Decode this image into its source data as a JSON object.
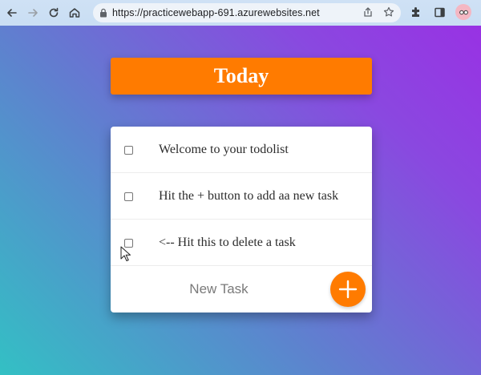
{
  "browser": {
    "url": "https://practicewebapp-691.azurewebsites.net",
    "icons": [
      "back-arrow-icon",
      "forward-arrow-icon",
      "reload-icon",
      "home-icon",
      "lock-icon",
      "share-icon",
      "star-icon",
      "extensions-icon",
      "side-panel-icon",
      "profile-avatar",
      "menu-dots-icon"
    ]
  },
  "app": {
    "title": "Today",
    "accent_color": "#ff7b00",
    "tasks": [
      {
        "label": "Welcome to your todolist",
        "checked": false
      },
      {
        "label": "Hit the + button to add aa new task",
        "checked": false
      },
      {
        "label": "<-- Hit this to delete a task",
        "checked": false
      }
    ],
    "new_task": {
      "placeholder": "New Task",
      "add_icon": "plus-icon"
    }
  }
}
